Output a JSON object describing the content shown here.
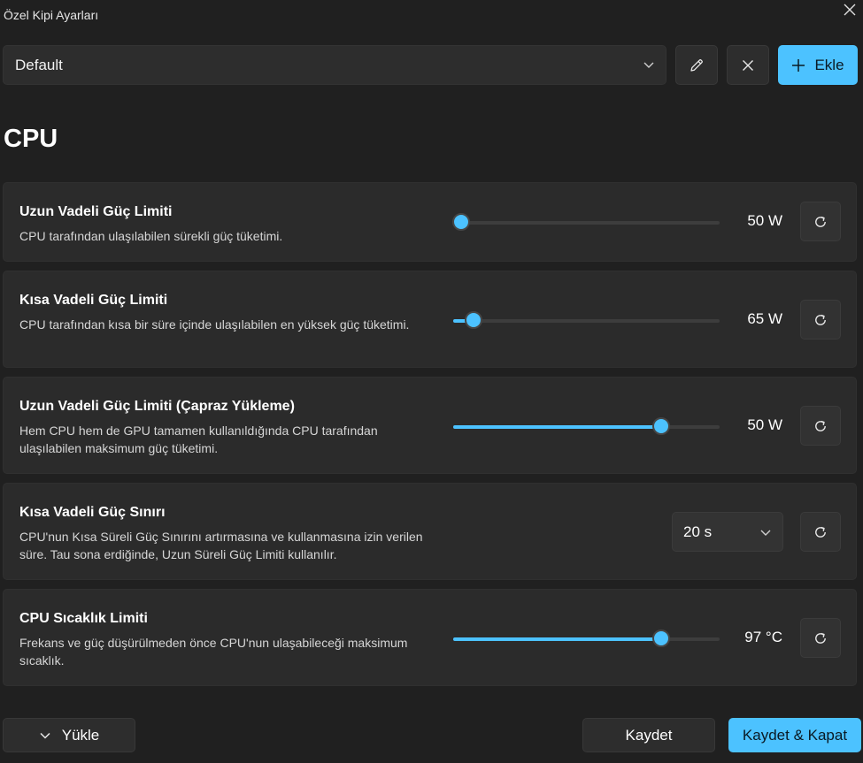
{
  "window": {
    "title": "Özel Kipi Ayarları"
  },
  "toolbar": {
    "preset_value": "Default",
    "add_label": "Ekle"
  },
  "section": {
    "title": "CPU"
  },
  "settings": [
    {
      "title": "Uzun Vadeli Güç Limiti",
      "description": "CPU tarafından ulaşılabilen sürekli güç tüketimi.",
      "control": "slider",
      "slider_fraction": 0.03,
      "value": "50 W"
    },
    {
      "title": "Kısa Vadeli Güç Limiti",
      "description": "CPU tarafından kısa bir süre içinde ulaşılabilen en yüksek güç tüketimi.",
      "control": "slider",
      "slider_fraction": 0.075,
      "value": "65 W"
    },
    {
      "title": "Uzun Vadeli Güç Limiti (Çapraz Yükleme)",
      "description": "Hem CPU hem de GPU tamamen kullanıldığında CPU tarafından ulaşılabilen maksimum güç tüketimi.",
      "control": "slider",
      "slider_fraction": 0.78,
      "value": "50 W"
    },
    {
      "title": "Kısa Vadeli Güç Sınırı",
      "description": "CPU'nun Kısa Süreli Güç Sınırını artırmasına ve kullanmasına izin verilen süre. Tau sona erdiğinde, Uzun Süreli Güç Limiti kullanılır.",
      "control": "dropdown",
      "value": "20 s"
    },
    {
      "title": "CPU Sıcaklık Limiti",
      "description": "Frekans ve güç düşürülmeden önce CPU'nun ulaşabileceği maksimum sıcaklık.",
      "control": "slider",
      "slider_fraction": 0.78,
      "value": "97 °C"
    }
  ],
  "footer": {
    "load_label": "Yükle",
    "save_label": "Kaydet",
    "save_close_label": "Kaydet & Kapat"
  },
  "colors": {
    "accent": "#4cc2ff",
    "background": "#202020",
    "card": "#2b2b2b"
  },
  "icons": {
    "close": "close-icon",
    "edit": "pencil-icon",
    "delete": "x-icon",
    "add": "plus-icon",
    "reset": "reset-icon",
    "chevron": "chevron-down-icon"
  }
}
